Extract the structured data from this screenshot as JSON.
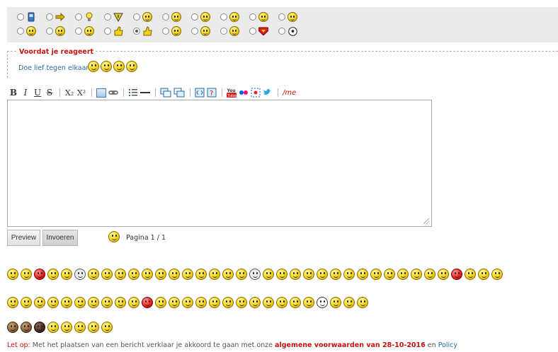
{
  "icon_selector": {
    "row1": [
      "phone-icon",
      "arrow-right-icon",
      "lightbulb-icon",
      "warning-icon",
      "smile-icon",
      "cool-icon",
      "happy-icon",
      "sad-icon",
      "grin-icon",
      "sunglasses-icon"
    ],
    "row2": [
      "laugh-icon",
      "surprised-icon",
      "smile-icon",
      "thumbs-icon",
      "thumbs-up-icon",
      "neutral-icon",
      "wink-icon",
      "blush-icon",
      "superman-icon",
      "football-icon"
    ],
    "selected_index_row2": 4
  },
  "notice": {
    "title": "Voordat je reageert",
    "text": "Doe lief tegen elkaar!"
  },
  "toolbar": {
    "bold": "B",
    "italic": "I",
    "underline": "U",
    "strike": "S",
    "subscript": "X₂",
    "superscript": "X²",
    "me": "/me",
    "youtube": "You"
  },
  "editor": {
    "value": ""
  },
  "buttons": {
    "preview": "Preview",
    "submit": "Invoeren"
  },
  "pager": {
    "label": "Pagina 1 / 1"
  },
  "footer": {
    "lead": "Let op:",
    "text": "Met het plaatsen van een bericht verklaar je akkoord te gaan met onze",
    "terms": "algemene voorwaarden van 28-10-2016",
    "and": "en",
    "policy": "Policy"
  },
  "colors": {
    "accent_red": "#c41212",
    "link_blue": "#2a6b9c",
    "strip_bg": "#ebebeb"
  }
}
